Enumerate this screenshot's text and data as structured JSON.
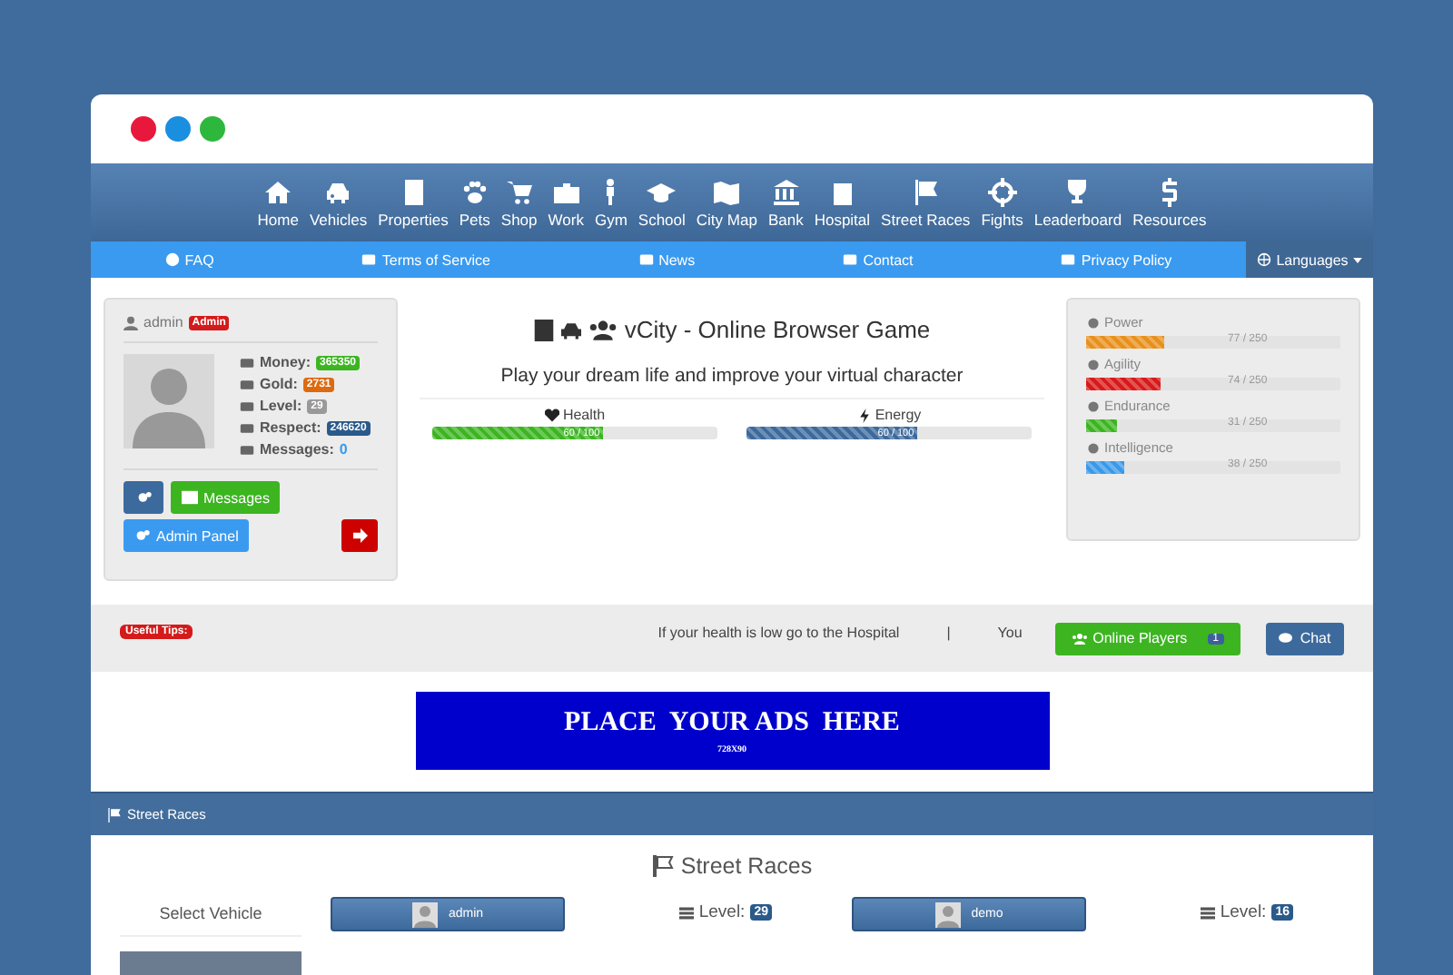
{
  "window": {
    "controls": [
      {
        "color": "#e8183c"
      },
      {
        "color": "#1a8fe0"
      },
      {
        "color": "#2db83d"
      }
    ]
  },
  "nav": {
    "items": [
      {
        "label": "Home"
      },
      {
        "label": "Vehicles"
      },
      {
        "label": "Properties"
      },
      {
        "label": "Pets"
      },
      {
        "label": "Shop"
      },
      {
        "label": "Work"
      },
      {
        "label": "Gym"
      },
      {
        "label": "School"
      },
      {
        "label": "City Map"
      },
      {
        "label": "Bank"
      },
      {
        "label": "Hospital"
      },
      {
        "label": "Street Races"
      },
      {
        "label": "Fights"
      },
      {
        "label": "Leaderboard"
      },
      {
        "label": "Resources"
      }
    ]
  },
  "subnav": {
    "items": [
      {
        "label": "FAQ"
      },
      {
        "label": "Terms of Service"
      },
      {
        "label": "News"
      },
      {
        "label": "Contact"
      },
      {
        "label": "Privacy Policy"
      }
    ],
    "languages": "Languages"
  },
  "profile": {
    "username": "admin",
    "role": "Admin",
    "stats": [
      {
        "label": "Money:",
        "value": "365350",
        "kind": "badge",
        "color": "#3cb521"
      },
      {
        "label": "Gold:",
        "value": "2731",
        "kind": "badge",
        "color": "#dd6a10"
      },
      {
        "label": "Level:",
        "value": "29",
        "kind": "badge",
        "color": "#999999"
      },
      {
        "label": "Respect:",
        "value": "246620",
        "kind": "badge",
        "color": "#2a5a8a"
      },
      {
        "label": "Messages:",
        "value": "0",
        "kind": "link",
        "color": "#3a9ae8"
      }
    ],
    "buttons": {
      "messages": "Messages",
      "admin_panel": "Admin Panel"
    }
  },
  "game": {
    "title": "vCity - Online Browser Game",
    "subtitle": "Play your dream life and improve your virtual character",
    "meters": [
      {
        "label": "Health",
        "reading": "60 / 100",
        "level": 0.6,
        "color": "#3cb521"
      },
      {
        "label": "Energy",
        "reading": "60 / 100",
        "level": 0.6,
        "color": "#3d6a9c"
      }
    ]
  },
  "attributes": [
    {
      "label": "Power",
      "reading": "77 / 250",
      "level": 0.308,
      "color": "#e8901c"
    },
    {
      "label": "Agility",
      "reading": "74 / 250",
      "level": 0.296,
      "color": "#d81a1a"
    },
    {
      "label": "Endurance",
      "reading": "31 / 250",
      "level": 0.124,
      "color": "#3cb521"
    },
    {
      "label": "Intelligence",
      "reading": "38 / 250",
      "level": 0.152,
      "color": "#3a9ae8"
    }
  ],
  "tips": {
    "label": "Useful Tips:",
    "text": "If your health is low go to the Hospital",
    "separator": "|",
    "you": "You",
    "online_players": "Online Players",
    "online_count": "1",
    "chat": "Chat"
  },
  "ad": {
    "headline": "PLACE  YOUR ADS  HERE",
    "size": "728X90"
  },
  "street_races": {
    "header": "Street Races",
    "title": "Street Races",
    "select_vehicle": "Select Vehicle",
    "racers": [
      {
        "name": "admin",
        "level_label": "Level:",
        "level_value": "29"
      },
      {
        "name": "demo",
        "level_label": "Level:",
        "level_value": "16"
      }
    ]
  }
}
